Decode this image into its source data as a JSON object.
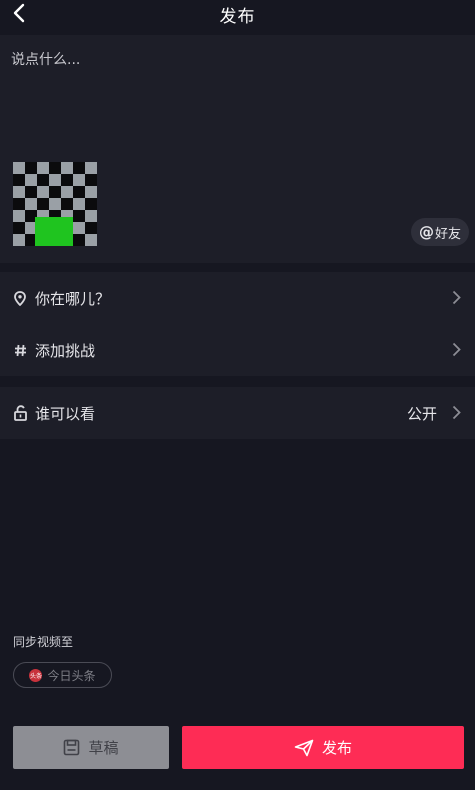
{
  "header": {
    "title": "发布",
    "back_icon": "chevron-left-icon"
  },
  "compose": {
    "placeholder": "说点什么...",
    "mention_button": {
      "at": "@",
      "label": "好友"
    }
  },
  "options": [
    {
      "icon": "location-pin-icon",
      "label": "你在哪儿？"
    },
    {
      "icon": "hashtag-icon",
      "label": "添加挑战"
    }
  ],
  "visibility": {
    "icon": "unlock-icon",
    "label": "谁可以看",
    "value": "公开"
  },
  "sync": {
    "label": "同步视频至",
    "target": {
      "logo_text": "头条",
      "label": "今日头条"
    }
  },
  "actions": {
    "draft_label": "草稿",
    "publish_label": "发布"
  },
  "colors": {
    "background": "#161721",
    "panel": "#1d1e28",
    "accent": "#fe2c55",
    "draft_button": "#8d8e94"
  }
}
